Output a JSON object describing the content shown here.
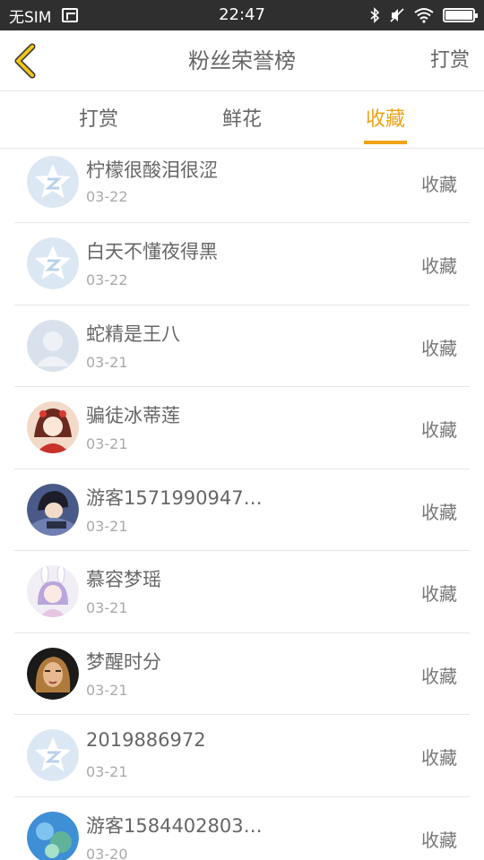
{
  "status_bar": {
    "carrier": "无SIM",
    "time": "22:47",
    "icons": [
      "screenshot-icon",
      "bluetooth-icon",
      "mute-icon",
      "wifi-icon",
      "battery-icon"
    ]
  },
  "header": {
    "title": "粉丝荣誉榜",
    "right_action": "打赏",
    "back_icon": "chevron-left-icon",
    "accent": "#f0a318"
  },
  "tabs": [
    {
      "label": "打赏",
      "active": false
    },
    {
      "label": "鲜花",
      "active": false
    },
    {
      "label": "收藏",
      "active": true
    }
  ],
  "list": [
    {
      "name": "柠檬很酸泪很涩",
      "date": "03-22",
      "action": "收藏",
      "avatar": "qq-star-avatar"
    },
    {
      "name": "白天不懂夜得黑",
      "date": "03-22",
      "action": "收藏",
      "avatar": "qq-star-avatar"
    },
    {
      "name": "蛇精是王八",
      "date": "03-21",
      "action": "收藏",
      "avatar": "default-person-avatar"
    },
    {
      "name": "骗徒冰蒂莲",
      "date": "03-21",
      "action": "收藏",
      "avatar": "anime-girl-red-avatar"
    },
    {
      "name": "游客1571990947…",
      "date": "03-21",
      "action": "收藏",
      "avatar": "anime-boy-avatar"
    },
    {
      "name": "慕容梦瑶",
      "date": "03-21",
      "action": "收藏",
      "avatar": "anime-bunny-girl-avatar"
    },
    {
      "name": "梦醒时分",
      "date": "03-21",
      "action": "收藏",
      "avatar": "portrait-woman-avatar"
    },
    {
      "name": "2019886972",
      "date": "03-21",
      "action": "收藏",
      "avatar": "qq-star-avatar"
    },
    {
      "name": "游客1584402803…",
      "date": "03-20",
      "action": "收藏",
      "avatar": "nature-blue-avatar"
    }
  ]
}
